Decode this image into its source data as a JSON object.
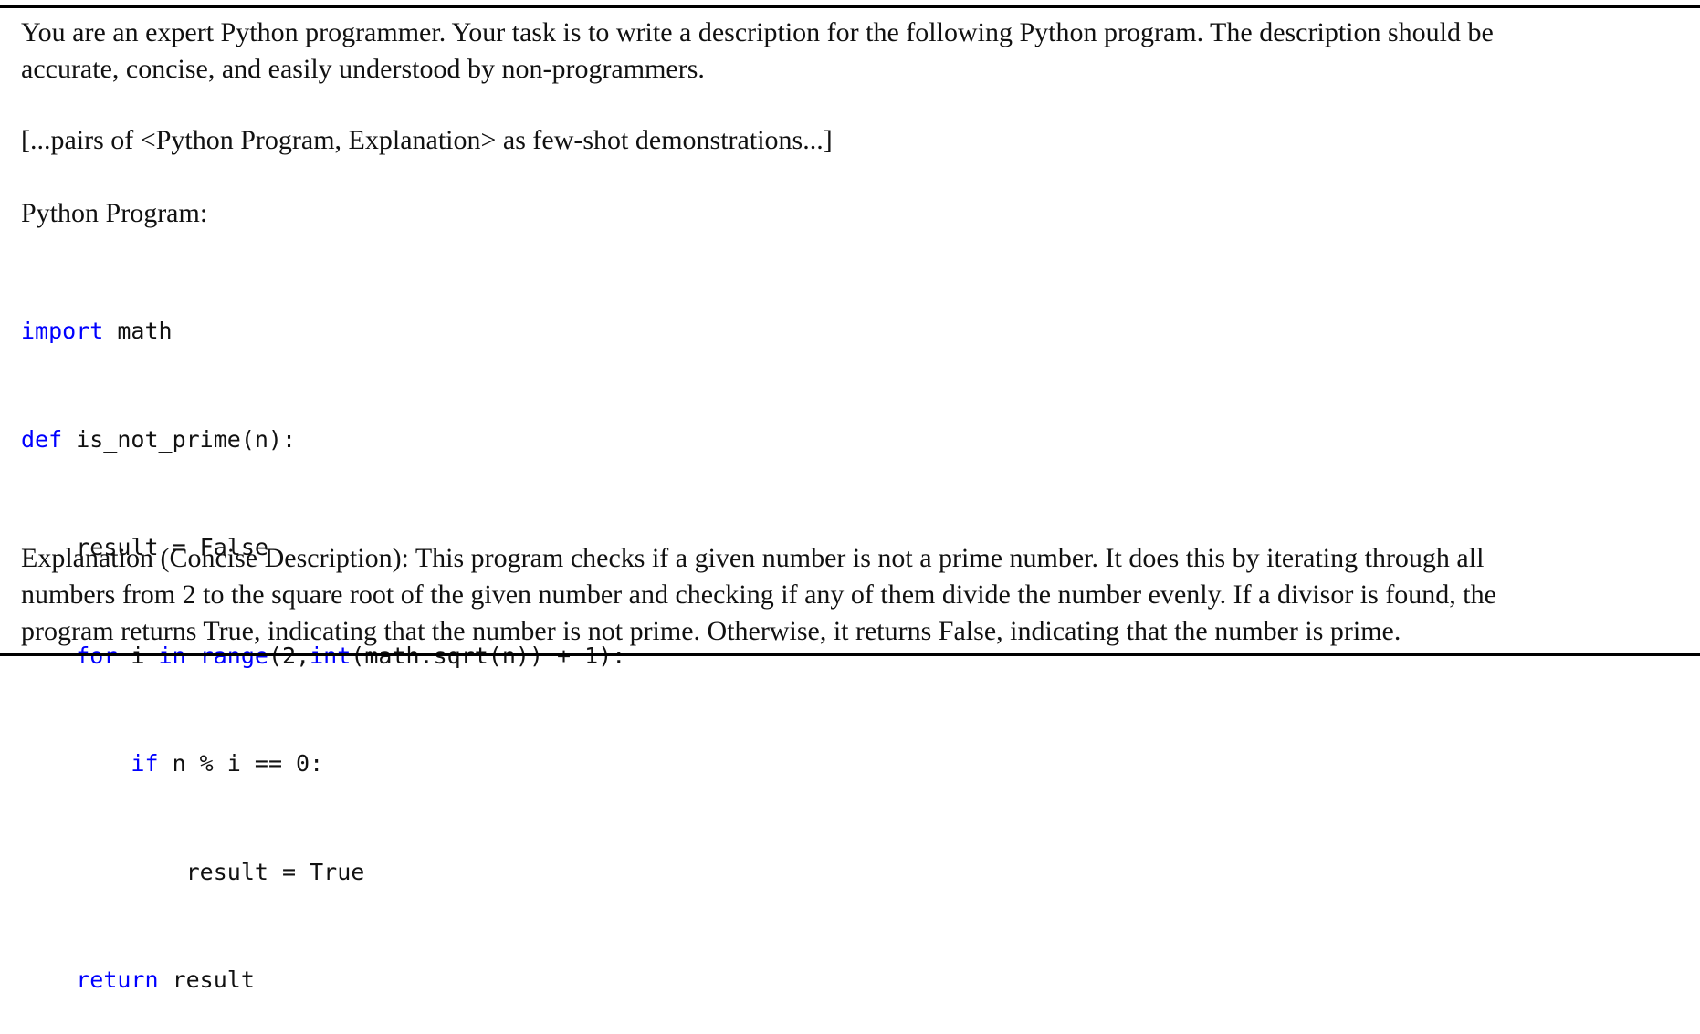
{
  "intro": {
    "line1": "You are an expert Python programmer. Your task is to write a description for the following Python program. The description should be",
    "line2": "accurate, concise, and easily understood by non-programmers."
  },
  "demonstrations_placeholder": "[...pairs of <Python Program, Explanation> as few-shot demonstrations...]",
  "program_heading": "Python Program:",
  "code": {
    "line1": {
      "kw": "import",
      "rest": " math"
    },
    "line2": {
      "kw": "def",
      "rest": " is_not_prime(n):"
    },
    "line3": {
      "indent": "    ",
      "rest": "result = False"
    },
    "line4": {
      "indent": "    ",
      "kw1": "for",
      "t1": " i ",
      "kw2": "in",
      "t2": " ",
      "kw3": "range",
      "t3": "(2,",
      "kw4": "int",
      "t4": "(math.sqrt(n)) + 1):"
    },
    "line5": {
      "indent": "        ",
      "kw": "if",
      "rest": " n % i == 0:"
    },
    "line6": {
      "indent": "            ",
      "rest": "result = True"
    },
    "line7": {
      "indent": "    ",
      "kw": "return",
      "rest": " result"
    }
  },
  "explanation": {
    "line1": "Explanation (Concise Description): This program checks if a given number is not a prime number. It does this by iterating through all",
    "line2": "numbers from 2 to the square root of the given number and checking if any of them divide the number evenly. If a divisor is found, the",
    "line3": "program returns True, indicating that the number is not prime. Otherwise, it returns False, indicating that the number is prime."
  },
  "colors": {
    "keyword": "#0000ff",
    "text": "#111111",
    "rule": "#000000"
  }
}
